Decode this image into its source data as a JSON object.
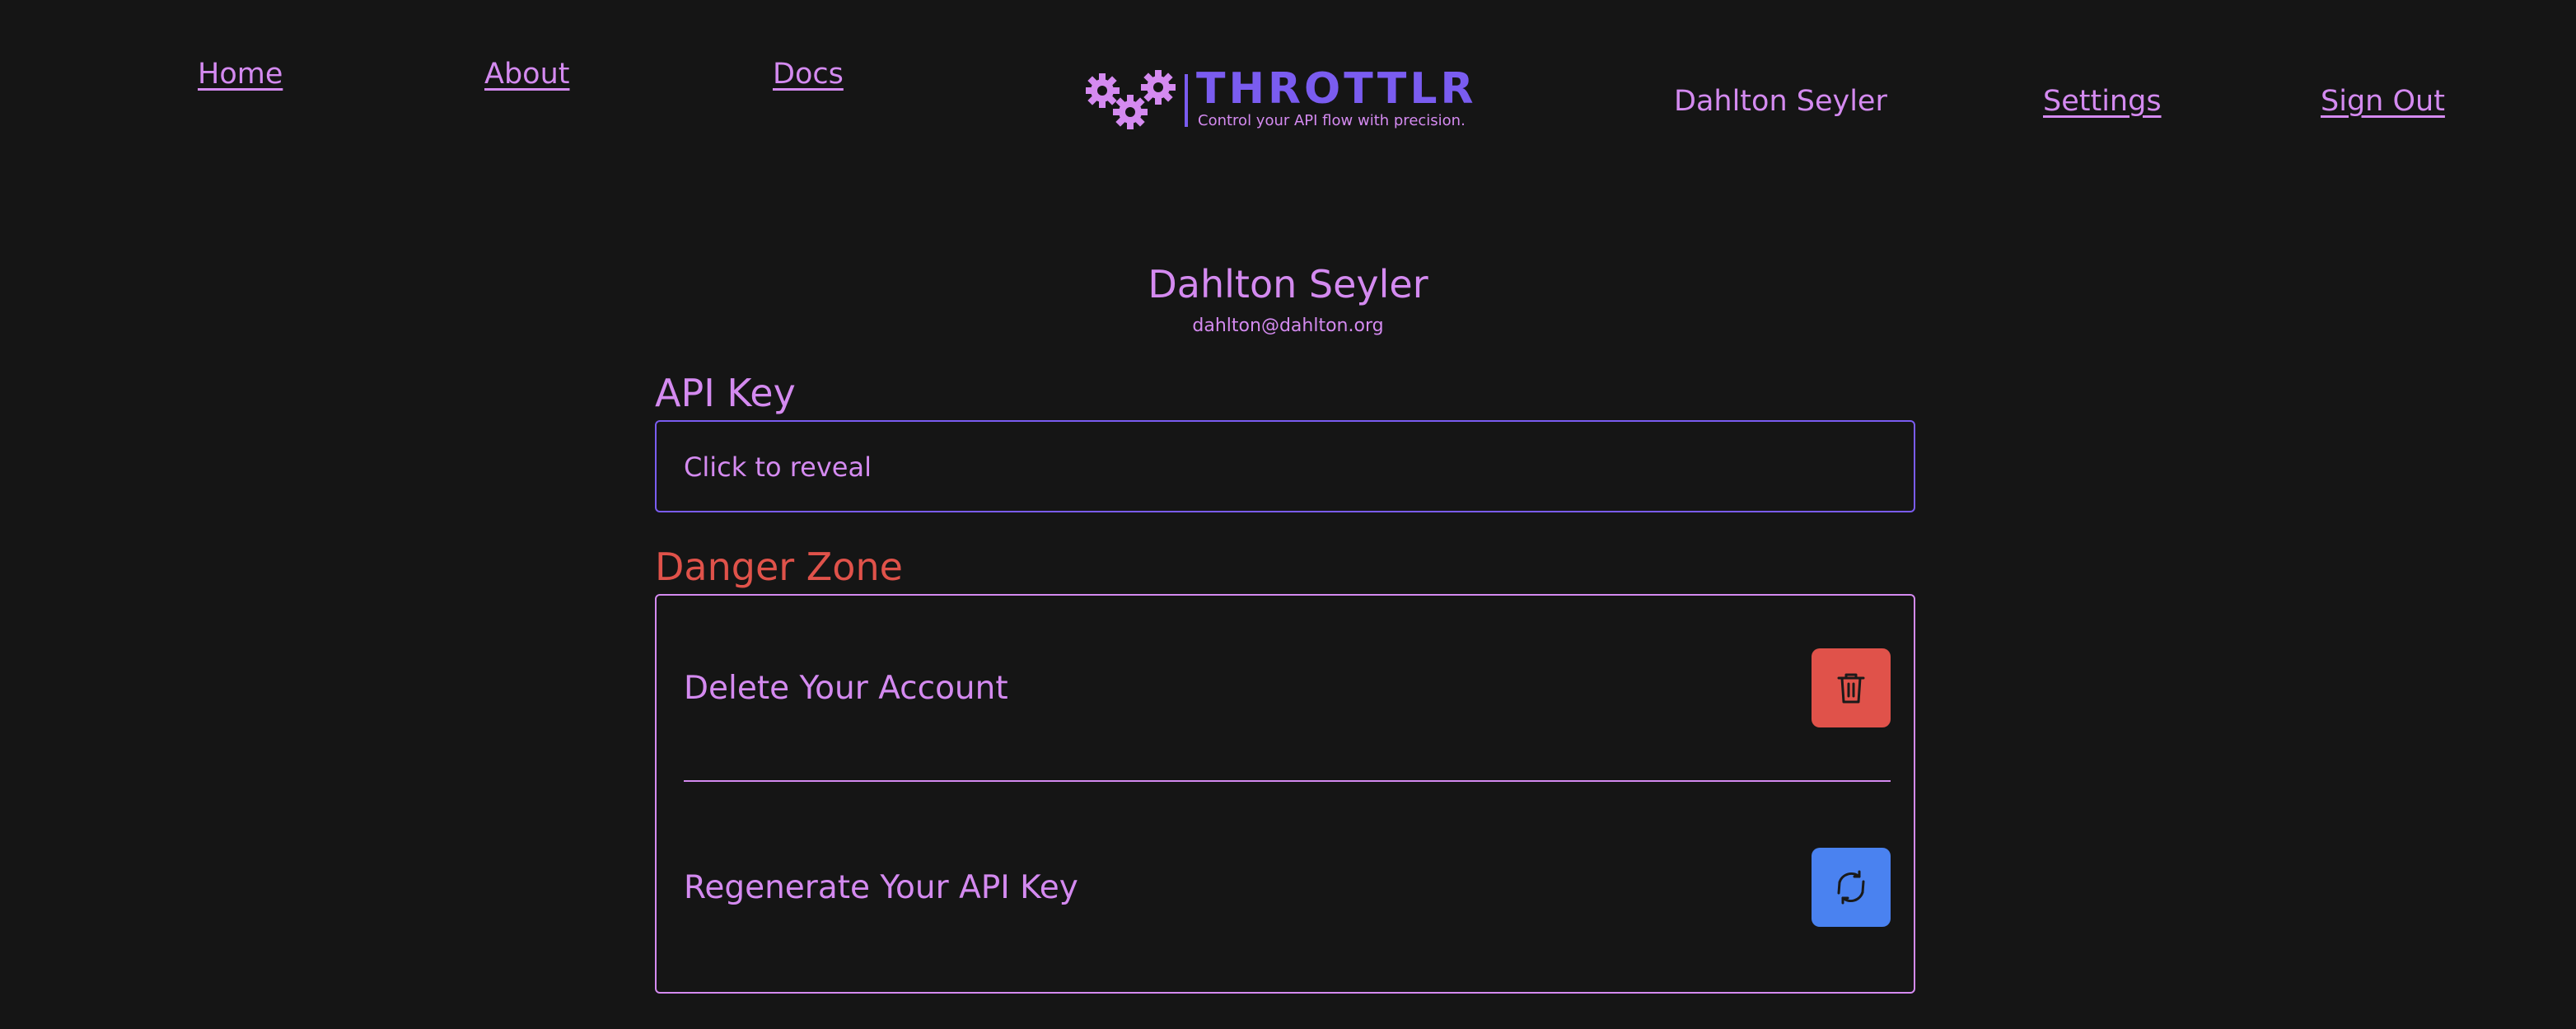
{
  "nav": {
    "home": "Home",
    "about": "About",
    "docs": "Docs",
    "user_name": "Dahlton Seyler",
    "settings": "Settings",
    "sign_out": "Sign Out"
  },
  "logo": {
    "wordmark": "THROTTLR",
    "tagline": "Control your API flow with precision.",
    "icon": "gears-icon"
  },
  "profile": {
    "name": "Dahlton Seyler",
    "email": "dahlton@dahlton.org"
  },
  "api_key": {
    "heading": "API Key",
    "reveal_text": "Click to reveal"
  },
  "danger_zone": {
    "heading": "Danger Zone",
    "delete_label": "Delete Your Account",
    "delete_icon": "trash-icon",
    "regenerate_label": "Regenerate Your API Key",
    "regenerate_icon": "refresh-icon"
  },
  "colors": {
    "background": "#151515",
    "text": "#d48af0",
    "brand": "#7a5cf0",
    "danger": "#e0524a",
    "primary": "#4a82f0"
  }
}
